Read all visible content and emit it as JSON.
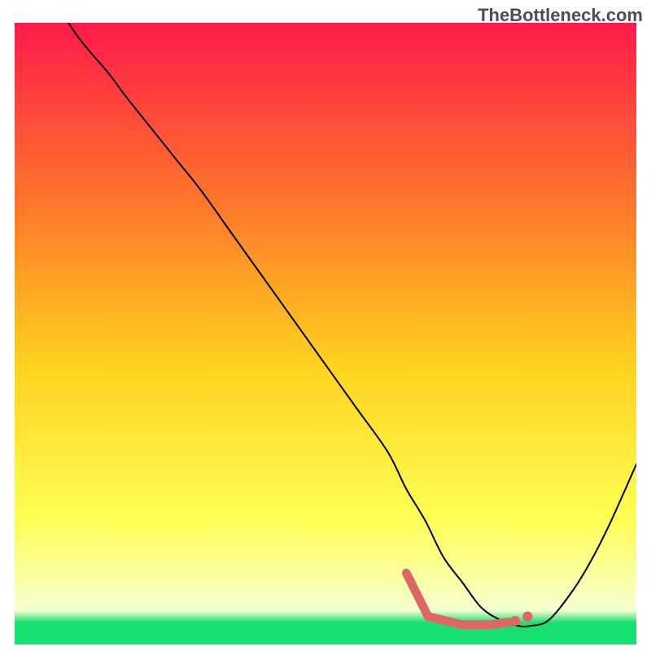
{
  "watermark": "TheBottleneck.com",
  "colors": {
    "gradient_top": "#ff1a4a",
    "gradient_mid_top": "#ff7a2a",
    "gradient_mid": "#ffd21e",
    "gradient_mid_bottom": "#ffff55",
    "gradient_low": "#f5ffd0",
    "gradient_bottom": "#15e070",
    "curve": "#000000",
    "marker": "#e06666"
  },
  "chart_data": {
    "type": "line",
    "title": "",
    "xlabel": "",
    "ylabel": "",
    "xlim": [
      0,
      100
    ],
    "ylim": [
      0,
      100
    ],
    "series": [
      {
        "name": "bottleneck-curve",
        "x": [
          0,
          5,
          10,
          15,
          18,
          22,
          26,
          30,
          35,
          40,
          45,
          50,
          55,
          60,
          63,
          66,
          69,
          72,
          75,
          78,
          81,
          83,
          86,
          90,
          93,
          96,
          100
        ],
        "y": [
          115,
          106,
          98,
          92,
          88,
          83,
          78,
          73,
          66,
          59,
          52,
          45,
          38,
          31,
          25,
          20,
          14,
          10,
          6,
          4,
          3,
          3,
          4,
          9,
          14,
          20,
          29
        ]
      }
    ],
    "markers": [
      {
        "name": "flat-min-segment",
        "type": "polyline",
        "x": [
          63,
          66.5,
          72,
          76.5,
          79.5
        ],
        "y": [
          11.5,
          4.5,
          3.2,
          3.2,
          3.6
        ]
      },
      {
        "name": "flat-dot-1",
        "type": "dot",
        "x": 80.5,
        "y": 3.8
      },
      {
        "name": "flat-dot-2",
        "type": "dot",
        "x": 82.5,
        "y": 4.5
      }
    ]
  }
}
